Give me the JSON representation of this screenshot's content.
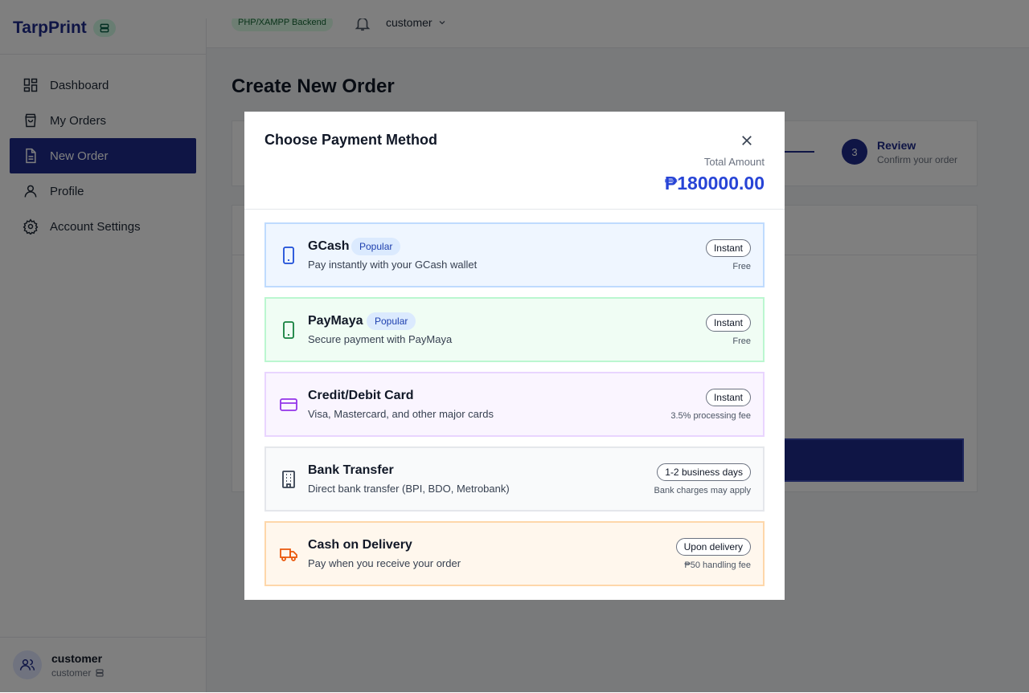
{
  "brand": {
    "name": "TarpPrint"
  },
  "sidebar": {
    "items": [
      {
        "label": "Dashboard",
        "icon": "dashboard-icon"
      },
      {
        "label": "My Orders",
        "icon": "shopping-bag-icon"
      },
      {
        "label": "New Order",
        "icon": "file-icon",
        "active": true
      },
      {
        "label": "Profile",
        "icon": "user-icon"
      },
      {
        "label": "Account Settings",
        "icon": "gear-icon"
      }
    ],
    "user": {
      "name": "customer",
      "role": "customer"
    }
  },
  "header": {
    "backend_badge": "PHP/XAMPP Backend",
    "user_menu": "customer",
    "has_notification": true
  },
  "page": {
    "title": "Create New Order",
    "step": {
      "number": "3",
      "title": "Review",
      "subtitle": "Confirm your order"
    }
  },
  "modal": {
    "title": "Choose Payment Method",
    "total_label": "Total Amount",
    "total_value": "₱180000.00",
    "methods": [
      {
        "name": "GCash",
        "badge": "Popular",
        "description": "Pay instantly with your GCash wallet",
        "speed": "Instant",
        "fee": "Free",
        "icon": "smartphone-icon",
        "color": "#1d4ed8",
        "bg": "#eff6ff",
        "border": "#bfdbfe"
      },
      {
        "name": "PayMaya",
        "badge": "Popular",
        "description": "Secure payment with PayMaya",
        "speed": "Instant",
        "fee": "Free",
        "icon": "smartphone-icon",
        "color": "#15803d",
        "bg": "#f0fdf4",
        "border": "#bbf7d0"
      },
      {
        "name": "Credit/Debit Card",
        "description": "Visa, Mastercard, and other major cards",
        "speed": "Instant",
        "fee": "3.5% processing fee",
        "icon": "credit-card-icon",
        "color": "#9333ea",
        "bg": "#faf5ff",
        "border": "#e9d5ff"
      },
      {
        "name": "Bank Transfer",
        "description": "Direct bank transfer (BPI, BDO, Metrobank)",
        "speed": "1-2 business days",
        "fee": "Bank charges may apply",
        "icon": "building-icon",
        "color": "#374151",
        "bg": "#f9fafb",
        "border": "#e5e7eb"
      },
      {
        "name": "Cash on Delivery",
        "description": "Pay when you receive your order",
        "speed": "Upon delivery",
        "fee": "₱50 handling fee",
        "icon": "truck-icon",
        "color": "#ea580c",
        "bg": "#fff7ed",
        "border": "#fed7aa"
      }
    ]
  },
  "colors": {
    "primary": "#1e2a8a",
    "accent": "#2744d6"
  }
}
